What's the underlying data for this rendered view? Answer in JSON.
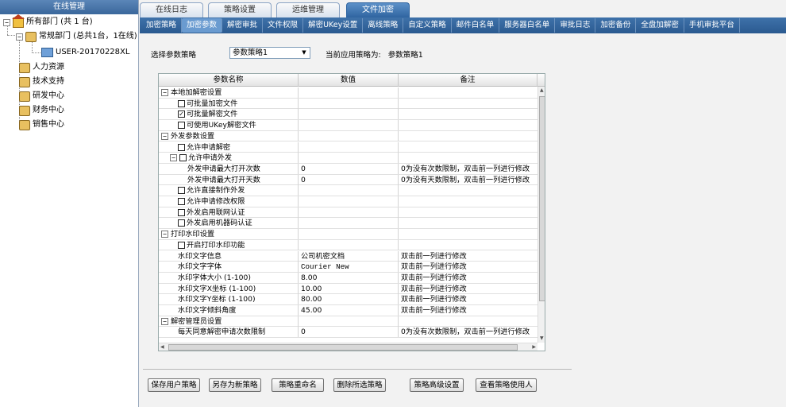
{
  "left_panel": {
    "title": "在线管理",
    "tree": [
      {
        "label": "所有部门 (共 1 台)",
        "icon": "house-icon"
      },
      {
        "label": "常规部门 (总共1台，1在线)",
        "icon": "group-icon"
      },
      {
        "label": "USER-20170228XL",
        "icon": "computer-icon"
      },
      {
        "label": "人力资源",
        "icon": "group-icon"
      },
      {
        "label": "技术支持",
        "icon": "group-icon"
      },
      {
        "label": "研发中心",
        "icon": "group-icon"
      },
      {
        "label": "财务中心",
        "icon": "group-icon"
      },
      {
        "label": "销售中心",
        "icon": "group-icon"
      }
    ]
  },
  "main_tabs": [
    "在线日志",
    "策略设置",
    "运维管理",
    "文件加密"
  ],
  "active_main_tab": "文件加密",
  "sub_tabs": [
    "加密策略",
    "加密参数",
    "解密审批",
    "文件权限",
    "解密UKey设置",
    "离线策略",
    "自定义策略",
    "邮件白名单",
    "服务器白名单",
    "审批日志",
    "加密备份",
    "全盘加解密",
    "手机审批平台"
  ],
  "active_sub_tab": "加密参数",
  "policy": {
    "label": "选择参数策略",
    "selected": "参数策略1",
    "applied_label": "当前应用策略为:",
    "applied_value": "参数策略1"
  },
  "grid": {
    "headers": [
      "参数名称",
      "数值",
      "备注"
    ],
    "rows": [
      {
        "name": "本地加解密设置",
        "value": "",
        "note": "",
        "type": "group"
      },
      {
        "name": "可批量加密文件",
        "value": "",
        "note": "",
        "type": "check",
        "checked": false
      },
      {
        "name": "可批量解密文件",
        "value": "",
        "note": "",
        "type": "check",
        "checked": true
      },
      {
        "name": "可使用UKey解密文件",
        "value": "",
        "note": "",
        "type": "check",
        "checked": false
      },
      {
        "name": "外发参数设置",
        "value": "",
        "note": "",
        "type": "group"
      },
      {
        "name": "允许申请解密",
        "value": "",
        "note": "",
        "type": "check",
        "checked": false
      },
      {
        "name": "允许申请外发",
        "value": "",
        "note": "",
        "type": "subgroup",
        "checked": false
      },
      {
        "name": "外发申请最大打开次数",
        "value": "0",
        "note": "0为没有次数限制，双击前一列进行修改",
        "type": "leaf2"
      },
      {
        "name": "外发申请最大打开天数",
        "value": "0",
        "note": "0为没有天数限制，双击前一列进行修改",
        "type": "leaf2"
      },
      {
        "name": "允许直接制作外发",
        "value": "",
        "note": "",
        "type": "check",
        "checked": false
      },
      {
        "name": "允许申请修改权限",
        "value": "",
        "note": "",
        "type": "check",
        "checked": false
      },
      {
        "name": "外发启用联网认证",
        "value": "",
        "note": "",
        "type": "check",
        "checked": false
      },
      {
        "name": "外发启用机器码认证",
        "value": "",
        "note": "",
        "type": "check",
        "checked": false
      },
      {
        "name": "打印水印设置",
        "value": "",
        "note": "",
        "type": "group"
      },
      {
        "name": "开启打印水印功能",
        "value": "",
        "note": "",
        "type": "check",
        "checked": false
      },
      {
        "name": "水印文字信息",
        "value": "公司机密文档",
        "note": "双击前一列进行修改",
        "type": "leaf"
      },
      {
        "name": "水印文字字体",
        "value": "Courier New",
        "note": "双击前一列进行修改",
        "type": "leaf"
      },
      {
        "name": "水印字体大小 (1-100)",
        "value": "8.00",
        "note": "双击前一列进行修改",
        "type": "leaf"
      },
      {
        "name": "水印文字X坐标 (1-100)",
        "value": "10.00",
        "note": "双击前一列进行修改",
        "type": "leaf"
      },
      {
        "name": "水印文字Y坐标 (1-100)",
        "value": "80.00",
        "note": "双击前一列进行修改",
        "type": "leaf"
      },
      {
        "name": "水印文字倾斜角度",
        "value": "45.00",
        "note": "双击前一列进行修改",
        "type": "leaf"
      },
      {
        "name": "解密管理员设置",
        "value": "",
        "note": "",
        "type": "group"
      },
      {
        "name": "每天同意解密申请次数限制",
        "value": "0",
        "note": "0为没有次数限制，双击前一列进行修改",
        "type": "leaf"
      }
    ]
  },
  "buttons": [
    "保存用户策略",
    "另存为新策略",
    "策略重命名",
    "删除所选策略",
    "策略高级设置",
    "查看策略使用人"
  ]
}
